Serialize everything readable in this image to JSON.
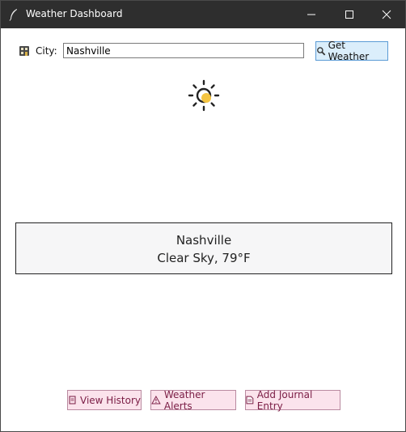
{
  "window": {
    "title": "Weather Dashboard",
    "controls": [
      "minimize",
      "maximize",
      "close"
    ]
  },
  "search": {
    "city_label": "City:",
    "city_value": "Nashville",
    "get_weather_label": "Get Weather"
  },
  "icons": {
    "app": "feather-icon",
    "city": "city-building-icon",
    "search": "magnifier-icon",
    "weather": "sun-icon"
  },
  "result": {
    "city": "Nashville",
    "condition": "Clear Sky, 79°F"
  },
  "actions": {
    "view_history": "View History",
    "weather_alerts": "Weather Alerts",
    "add_journal_entry": "Add Journal Entry"
  },
  "colors": {
    "titlebar": "#2e2e2e",
    "accent_button_bg": "#dbeefb",
    "accent_button_border": "#5b9bd5",
    "action_button_bg": "#fbe3ec",
    "action_button_text": "#7a1c44",
    "sun_core": "#f5c542"
  }
}
